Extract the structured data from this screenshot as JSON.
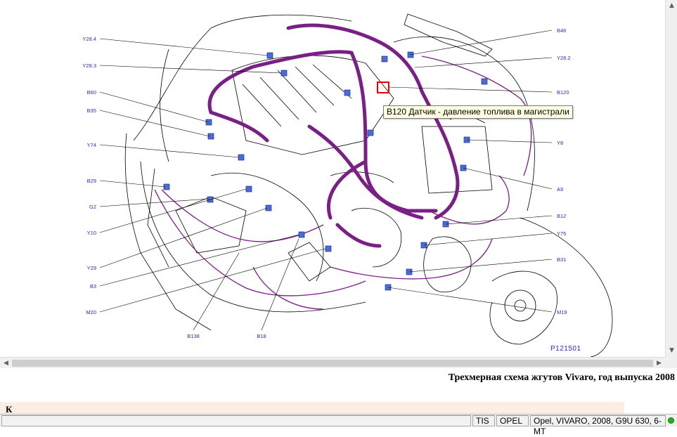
{
  "diagram": {
    "labels_left": [
      "Y28.4",
      "Y28.3",
      "B60",
      "B35",
      "Y74",
      "B29",
      "G2",
      "Y10",
      "Y29",
      "B3",
      "M20"
    ],
    "labels_bottom": [
      "B138",
      "B18"
    ],
    "labels_right": [
      "B46",
      "Y28.2",
      "B120",
      "1",
      "Y8",
      "A9",
      "B12",
      "Y75",
      "B31",
      "M19"
    ],
    "reference": "P121501",
    "tooltip": "B120 Датчик - давление топлива в магистрали",
    "colors": {
      "harness": "#7a1f86",
      "labels": "#2b2bb0",
      "highlight": "#e00000"
    }
  },
  "caption": "Трехмерная схема жгутов Vivaro, год выпуска 2008",
  "next_section": "К",
  "statusbar": {
    "app": "TIS",
    "brand": "OPEL",
    "vehicle": "Opel, VIVARO, 2008, G9U 630, 6-MT",
    "status_color": "#1db31d"
  },
  "scrollbars": {
    "left_arrow": "◀",
    "right_arrow": "▶",
    "up_arrow": "▲",
    "down_arrow": "▼"
  }
}
